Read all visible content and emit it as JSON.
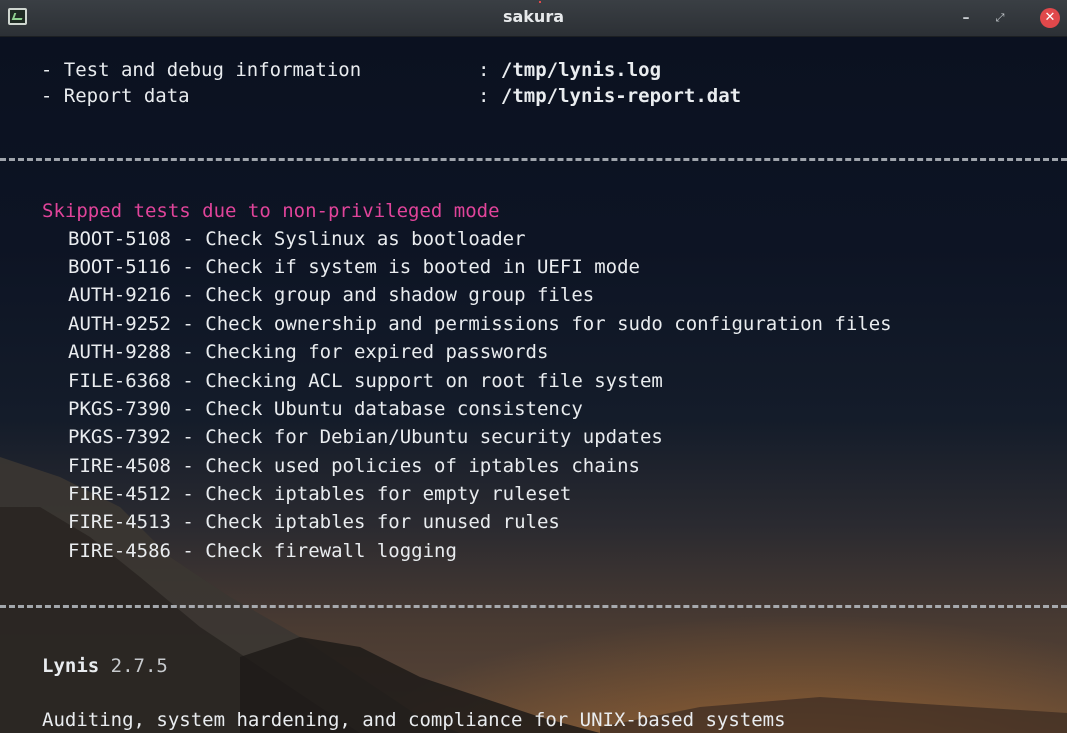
{
  "window": {
    "title": "sakura",
    "minimize_label": "–",
    "maximize_label": "⤢",
    "close_label": "✕"
  },
  "colors": {
    "heading": "#e0449a",
    "text": "#e9ecef",
    "close_button": "#e0484b"
  },
  "terminal": {
    "files": [
      {
        "label": "  - Test and debug information",
        "sep": ":",
        "value": "/tmp/lynis.log"
      },
      {
        "label": "  - Report data",
        "sep": ":",
        "value": "/tmp/lynis-report.dat"
      }
    ],
    "skipped_heading": "Skipped tests due to non-privileged mode",
    "skipped_tests": [
      "BOOT-5108 - Check Syslinux as bootloader",
      "BOOT-5116 - Check if system is booted in UEFI mode",
      "AUTH-9216 - Check group and shadow group files",
      "AUTH-9252 - Check ownership and permissions for sudo configuration files",
      "AUTH-9288 - Checking for expired passwords",
      "FILE-6368 - Checking ACL support on root file system",
      "PKGS-7390 - Check Ubuntu database consistency",
      "PKGS-7392 - Check for Debian/Ubuntu security updates",
      "FIRE-4508 - Check used policies of iptables chains",
      "FIRE-4512 - Check iptables for empty ruleset",
      "FIRE-4513 - Check iptables for unused rules",
      "FIRE-4586 - Check firewall logging"
    ],
    "product_name": "Lynis",
    "product_version": "2.7.5",
    "tagline": "Auditing, system hardening, and compliance for UNIX-based systems"
  }
}
